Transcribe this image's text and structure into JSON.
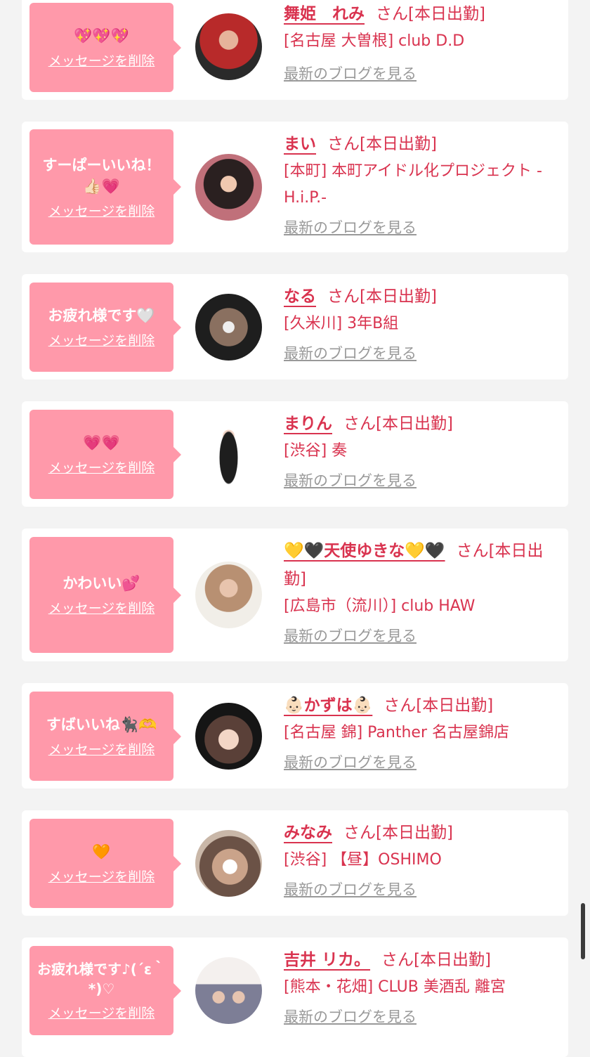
{
  "delete_label": "メッセージを削除",
  "blog_label": "最新のブログを見る",
  "accent_color": "#d9334f",
  "bubble_color": "#ff99aa",
  "cards": [
    {
      "message": "💖💖💖",
      "name": "舞姫　れみ",
      "suffix": "さん[本日出勤]",
      "shop": "[名古屋 大曽根] club D.D"
    },
    {
      "message": "すーぱーいいね！👍🏻💗",
      "name": "まい",
      "suffix": "さん[本日出勤]",
      "shop": "[本町] 本町アイドル化プロジェクト -H.i.P.-"
    },
    {
      "message": "お疲れ様です🤍",
      "name": "なる",
      "suffix": "さん[本日出勤]",
      "shop": "[久米川] 3年B組"
    },
    {
      "message": "💗💗",
      "name": "まりん",
      "suffix": "さん[本日出勤]",
      "shop": "[渋谷] 奏"
    },
    {
      "message": "かわいい💕",
      "name": "💛🖤天使ゆきな💛🖤",
      "suffix": "さん[本日出勤]",
      "shop": "[広島市（流川）] club HAW"
    },
    {
      "message": "すばいいね🐈‍⬛🫶",
      "name": "👶🏻かずは👶🏻",
      "suffix": "さん[本日出勤]",
      "shop": "[名古屋 錦] Panther 名古屋錦店"
    },
    {
      "message": "🧡",
      "name": "みなみ",
      "suffix": "さん[本日出勤]",
      "shop": "[渋谷] 【昼】OSHIMO"
    },
    {
      "message": "お疲れ様です♪(´ε｀*)♡",
      "name": "吉井 リカ。",
      "suffix": "さん[本日出勤]",
      "shop": "[熊本・花畑] CLUB 美酒乱 離宮"
    }
  ]
}
